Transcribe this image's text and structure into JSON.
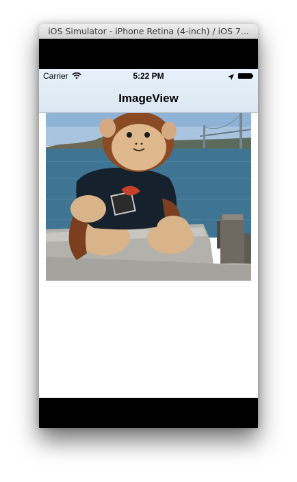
{
  "simulator": {
    "window_title": "iOS Simulator - iPhone Retina (4-inch) / iOS 7..."
  },
  "status_bar": {
    "carrier": "Carrier",
    "time": "5:22 PM"
  },
  "nav_bar": {
    "title": "ImageView"
  },
  "icons": [
    "wifi-icon",
    "location-arrow-icon",
    "battery-icon"
  ]
}
